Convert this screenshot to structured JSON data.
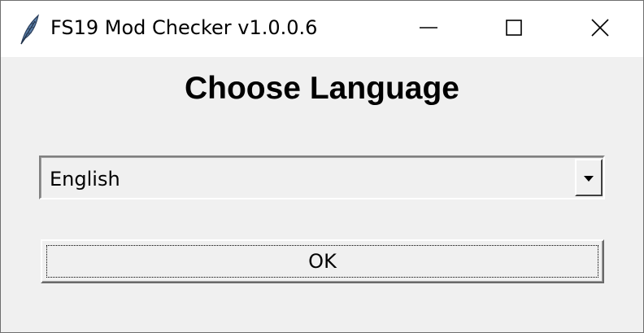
{
  "window": {
    "title": "FS19 Mod Checker v1.0.0.6",
    "icon": "feather-icon",
    "controls": {
      "minimize_icon": "minimize-icon",
      "maximize_icon": "maximize-icon",
      "close_icon": "close-icon"
    }
  },
  "dialog": {
    "heading": "Choose Language",
    "language_select": {
      "selected": "English",
      "arrow_icon": "dropdown-arrow-icon"
    },
    "ok_label": "OK"
  },
  "colors": {
    "titlebar": "#ffffff",
    "background": "#f0f0f0",
    "text": "#000000"
  }
}
